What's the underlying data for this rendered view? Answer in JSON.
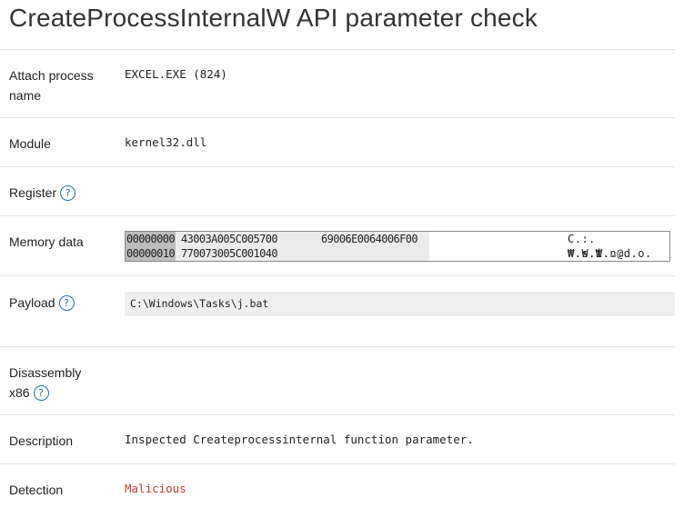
{
  "page": {
    "title": "CreateProcessInternalW API parameter check"
  },
  "fields": {
    "attach_process": {
      "label": "Attach process name",
      "value": "EXCEL.EXE (824)"
    },
    "module": {
      "label": "Module",
      "value": "kernel32.dll"
    },
    "register": {
      "label": "Register",
      "help": "?"
    },
    "memory_data": {
      "label": "Memory data",
      "rows": [
        {
          "address": "00000000",
          "hex1": "43003A005C005700",
          "hex2": "69006E0064006F00",
          "ascii": "C.:.₩.W.i.n.d.o."
        },
        {
          "address": "00000010",
          "hex1": "770073005C001040",
          "hex2": "",
          "ascii": "w.s.₩..@"
        }
      ]
    },
    "payload": {
      "label": "Payload",
      "help": "?",
      "value": "C:\\Windows\\Tasks\\j.bat"
    },
    "disassembly": {
      "label": "Disassembly x86",
      "help": "?"
    },
    "description": {
      "label": "Description",
      "value": "Inspected Createprocessinternal function parameter."
    },
    "detection": {
      "label": "Detection",
      "value": "Malicious",
      "color": "#c0392b"
    }
  },
  "icons": {
    "help": "help-circle-icon"
  },
  "colors": {
    "help_icon": "#1f6fb5",
    "detection_malicious": "#c0392b",
    "payload_background": "#efefef",
    "memory_address_background": "#bdbdbd"
  }
}
